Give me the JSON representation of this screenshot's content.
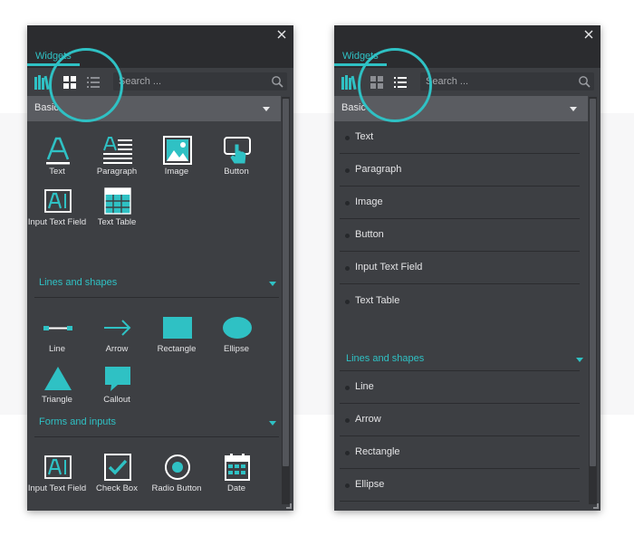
{
  "colors": {
    "accent": "#2fc1c4",
    "panel_bg": "#3d3f43",
    "titlebar_bg": "#2b2c2f",
    "section_bg": "#5a5c61",
    "text": "#e4e4e6"
  },
  "panel_grid": {
    "tab_label": "Widgets",
    "search_placeholder": "Search ...",
    "view_mode": "grid",
    "sections": [
      {
        "label": "Basic",
        "items": [
          {
            "label": "Text",
            "icon": "text-icon"
          },
          {
            "label": "Paragraph",
            "icon": "paragraph-icon"
          },
          {
            "label": "Image",
            "icon": "image-icon"
          },
          {
            "label": "Button",
            "icon": "button-icon"
          },
          {
            "label": "Input Text Field",
            "icon": "input-text-field-icon"
          },
          {
            "label": "Text Table",
            "icon": "text-table-icon"
          }
        ]
      },
      {
        "label": "Lines and shapes",
        "items": [
          {
            "label": "Line",
            "icon": "line-icon"
          },
          {
            "label": "Arrow",
            "icon": "arrow-icon"
          },
          {
            "label": "Rectangle",
            "icon": "rectangle-icon"
          },
          {
            "label": "Ellipse",
            "icon": "ellipse-icon"
          },
          {
            "label": "Triangle",
            "icon": "triangle-icon"
          },
          {
            "label": "Callout",
            "icon": "callout-icon"
          }
        ]
      },
      {
        "label": "Forms and inputs",
        "items": [
          {
            "label": "Input Text Field",
            "icon": "input-text-field-icon"
          },
          {
            "label": "Check Box",
            "icon": "check-box-icon"
          },
          {
            "label": "Radio Button",
            "icon": "radio-button-icon"
          },
          {
            "label": "Date",
            "icon": "date-icon"
          }
        ]
      }
    ]
  },
  "panel_list": {
    "tab_label": "Widgets",
    "search_placeholder": "Search ...",
    "view_mode": "list",
    "sections": [
      {
        "label": "Basic",
        "items": [
          "Text",
          "Paragraph",
          "Image",
          "Button",
          "Input Text Field",
          "Text Table"
        ]
      },
      {
        "label": "Lines and shapes",
        "items": [
          "Line",
          "Arrow",
          "Rectangle",
          "Ellipse"
        ]
      }
    ]
  }
}
